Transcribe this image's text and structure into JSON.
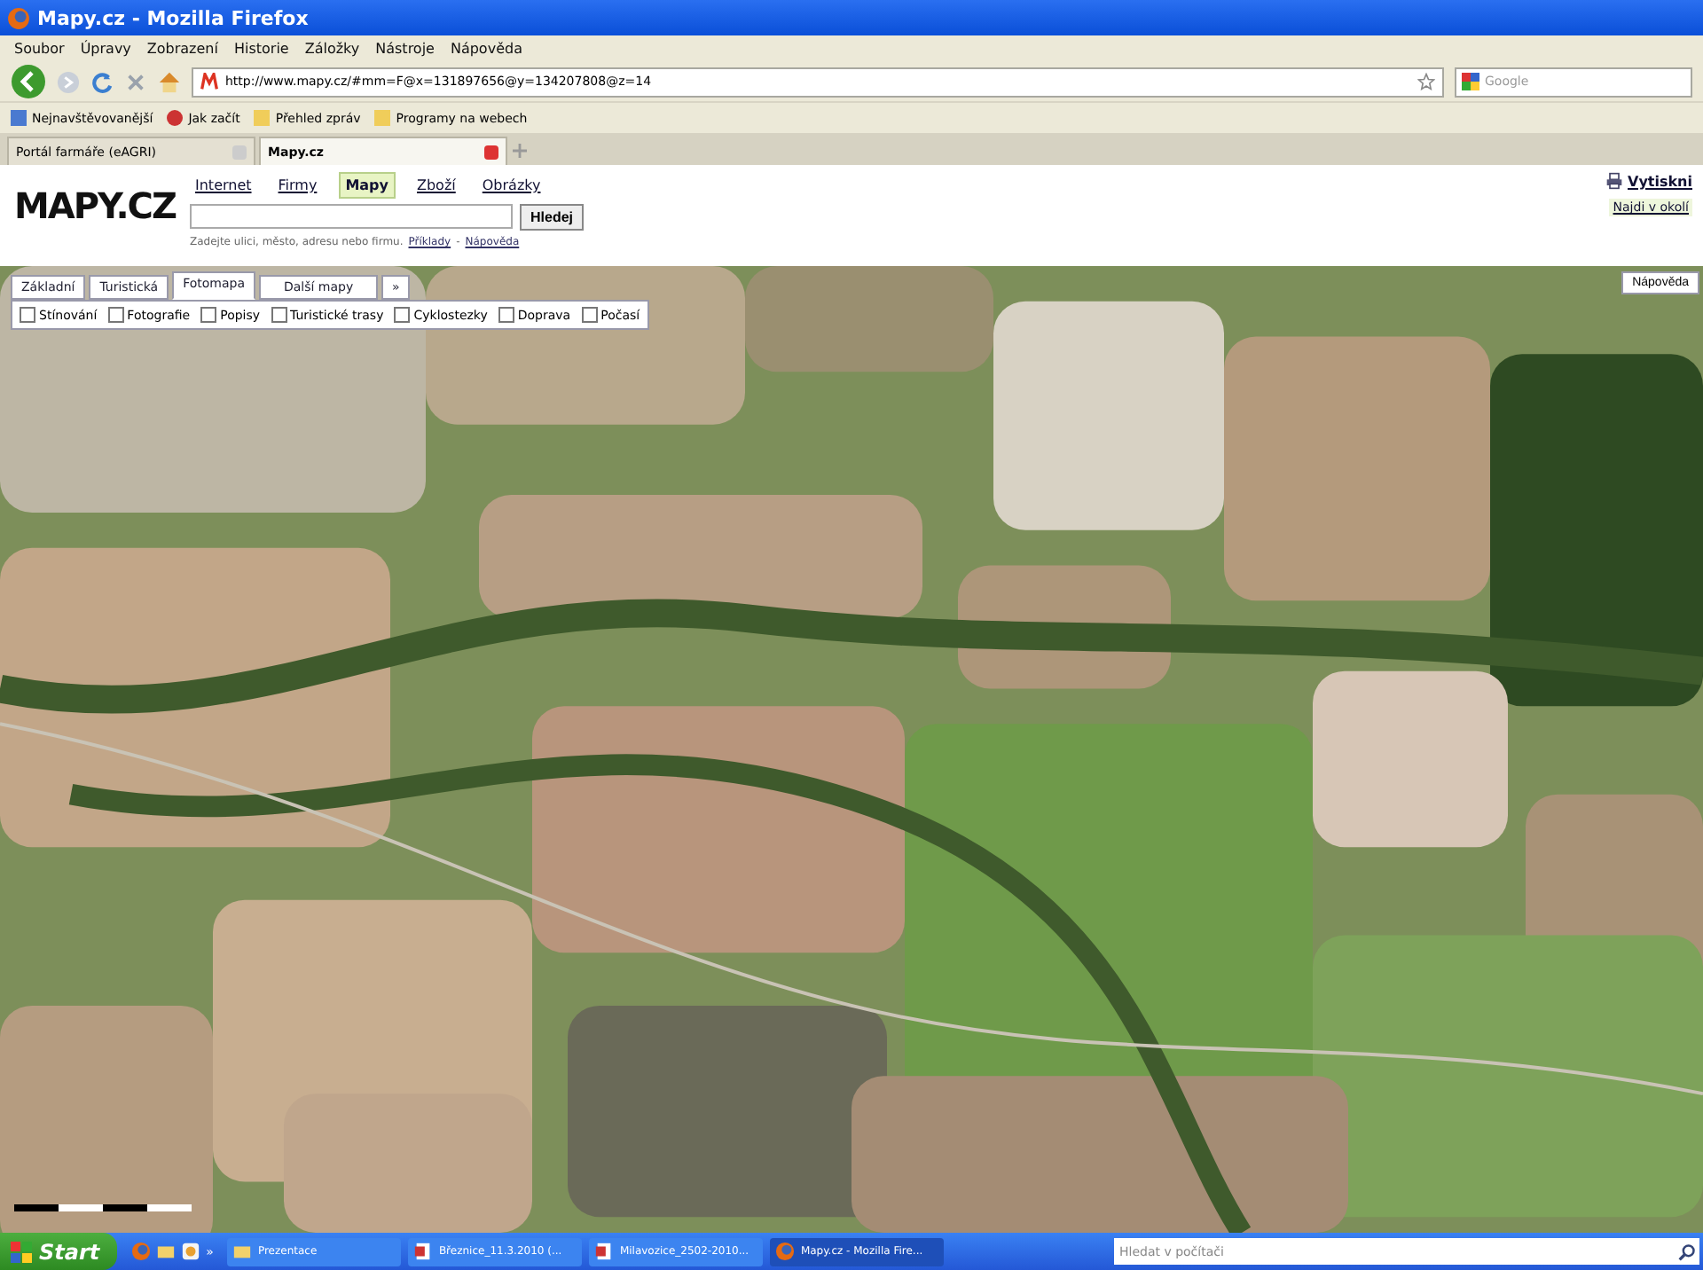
{
  "window": {
    "title": "Mapy.cz - Mozilla Firefox"
  },
  "menu": [
    "Soubor",
    "Úpravy",
    "Zobrazení",
    "Historie",
    "Záložky",
    "Nástroje",
    "Nápověda"
  ],
  "address_bar": {
    "value": "http://www.mapy.cz/#mm=F@x=131897656@y=134207808@z=14"
  },
  "search_bar": {
    "placeholder": "Google"
  },
  "bookmarks": [
    "Nejnavštěvovanější",
    "Jak začít",
    "Přehled zpráv",
    "Programy na webech"
  ],
  "tabs": [
    {
      "label": "Portál farmáře (eAGRI)",
      "selected": false
    },
    {
      "label": "Mapy.cz",
      "selected": true
    }
  ],
  "page": {
    "logo": "MAPY.CZ",
    "services": [
      {
        "label": "Internet",
        "selected": false
      },
      {
        "label": "Firmy",
        "selected": false
      },
      {
        "label": "Mapy",
        "selected": true
      },
      {
        "label": "Zboží",
        "selected": false
      },
      {
        "label": "Obrázky",
        "selected": false
      }
    ],
    "search_button": "Hledej",
    "hint": "Zadejte ulici, město, adresu nebo firmu.",
    "hint_links": [
      "Příklady",
      "Nápověda"
    ],
    "hint_separator": "-",
    "print_link": "Vytiskni",
    "nearby_link": "Najdi v okolí"
  },
  "map": {
    "types": [
      {
        "label": "Základní",
        "selected": false
      },
      {
        "label": "Turistická",
        "selected": false
      },
      {
        "label": "Fotomapa",
        "selected": true
      }
    ],
    "more_maps": "Další mapy",
    "more_toggle": "»",
    "layers": [
      {
        "label": "Stínování",
        "checked": false
      },
      {
        "label": "Fotografie",
        "checked": false
      },
      {
        "label": "Popisy",
        "checked": false
      },
      {
        "label": "Turistické trasy",
        "checked": false
      },
      {
        "label": "Cyklostezky",
        "checked": false
      },
      {
        "label": "Doprava",
        "checked": false
      },
      {
        "label": "Počasí",
        "checked": false
      }
    ],
    "help_button": "Nápověda"
  },
  "taskbar": {
    "start": "Start",
    "more": "»",
    "items": [
      {
        "label": "Prezentace",
        "kind": "folder",
        "selected": false
      },
      {
        "label": "Březnice_11.3.2010 (...",
        "kind": "doc",
        "selected": false
      },
      {
        "label": "Milavozice_2502-2010...",
        "kind": "doc",
        "selected": false
      },
      {
        "label": "Mapy.cz - Mozilla Fire...",
        "kind": "browser",
        "selected": true
      }
    ],
    "search": {
      "placeholder": "Hledat v počítači"
    }
  }
}
